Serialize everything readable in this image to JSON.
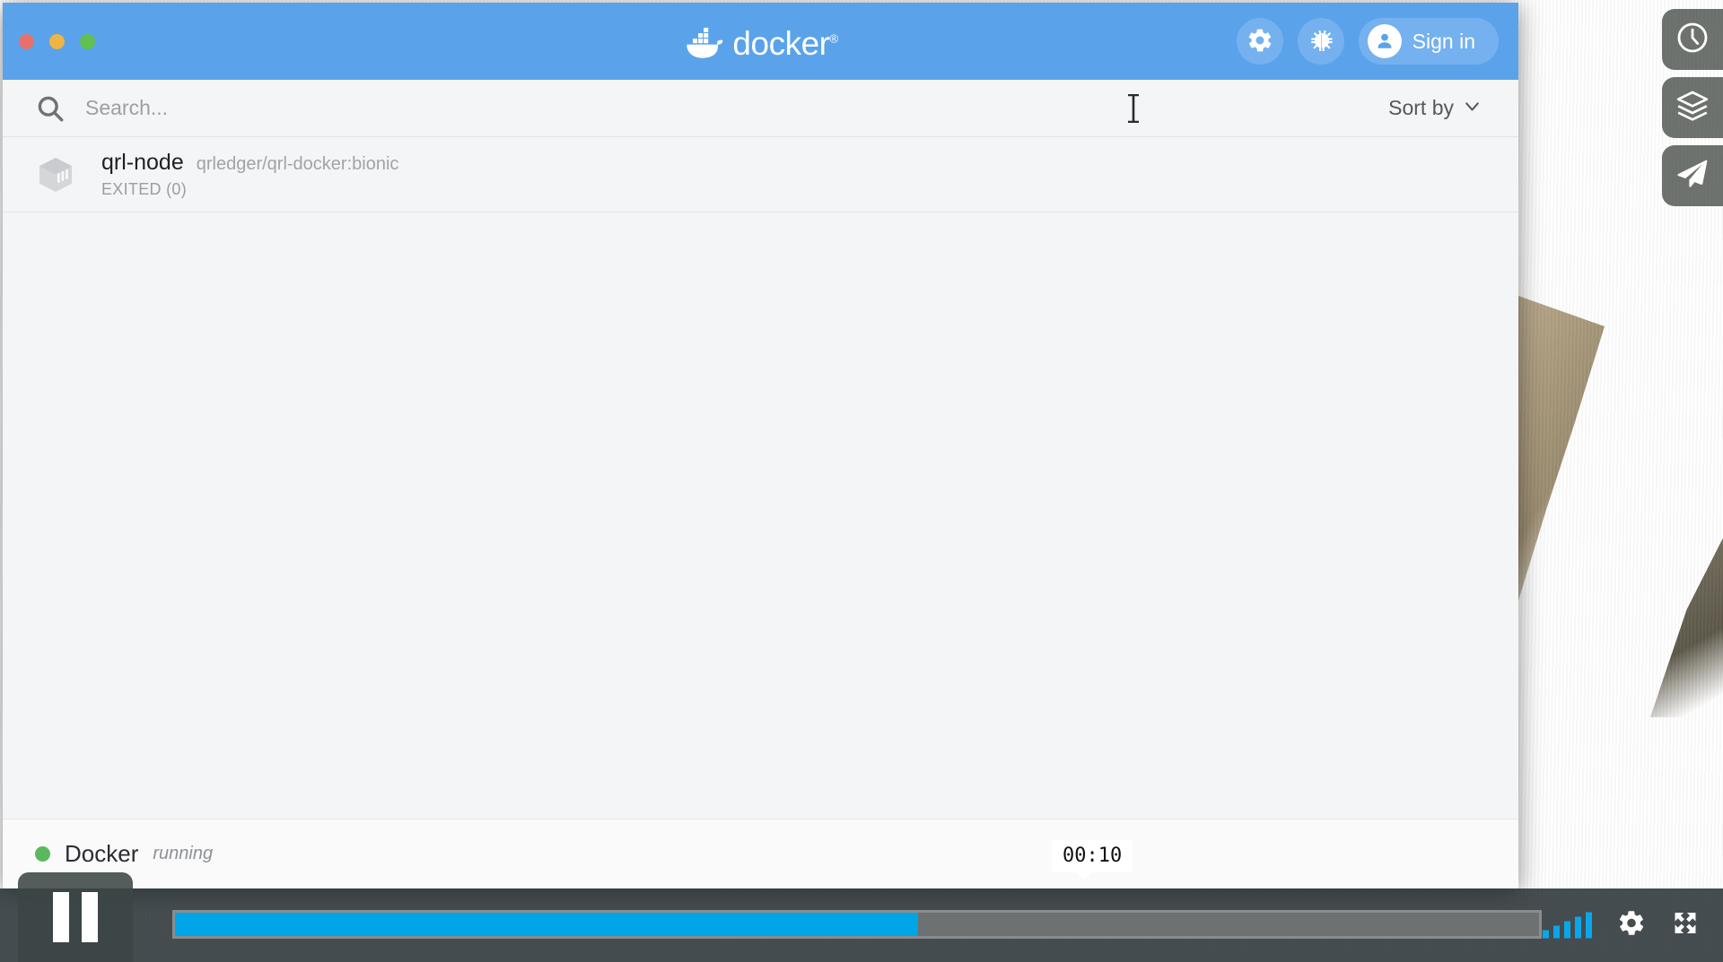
{
  "window": {
    "app_title": "docker",
    "wordmark_trademark": "®",
    "traffic_lights": [
      {
        "name": "close",
        "color": "#e8706a"
      },
      {
        "name": "minimize",
        "color": "#efb443"
      },
      {
        "name": "maximize",
        "color": "#62c051"
      }
    ],
    "titlebar": {
      "background": "#5aa3eb",
      "actions": [
        {
          "name": "settings",
          "icon": "gear-icon"
        },
        {
          "name": "troubleshoot",
          "icon": "bug-icon"
        }
      ],
      "signin_label": "Sign in",
      "signin_icon": "person-icon"
    }
  },
  "search": {
    "value": "",
    "placeholder": "Search...",
    "icon": "search-icon"
  },
  "sort": {
    "label": "Sort by",
    "icon": "chevron-down-icon"
  },
  "containers": [
    {
      "name": "qrl-node",
      "image": "qrledger/qrl-docker:bionic",
      "state": "EXITED (0)",
      "icon": "container-box-icon"
    }
  ],
  "status": {
    "engine": "Docker",
    "state": "running",
    "dot_color": "#5cb85c"
  },
  "player": {
    "play_state_icon": "pause-icon",
    "current_time": "00:10",
    "progress_percent": 54.5,
    "fill_color": "#00a5e8",
    "track_color": "#6e7172",
    "volume_icon": "volume-bars-icon",
    "settings_icon": "gear-icon",
    "fullscreen_icon": "fullscreen-icon"
  },
  "edge_dock": [
    {
      "name": "history",
      "icon": "clock-icon"
    },
    {
      "name": "layers",
      "icon": "layers-icon"
    },
    {
      "name": "send",
      "icon": "paper-plane-icon"
    }
  ]
}
